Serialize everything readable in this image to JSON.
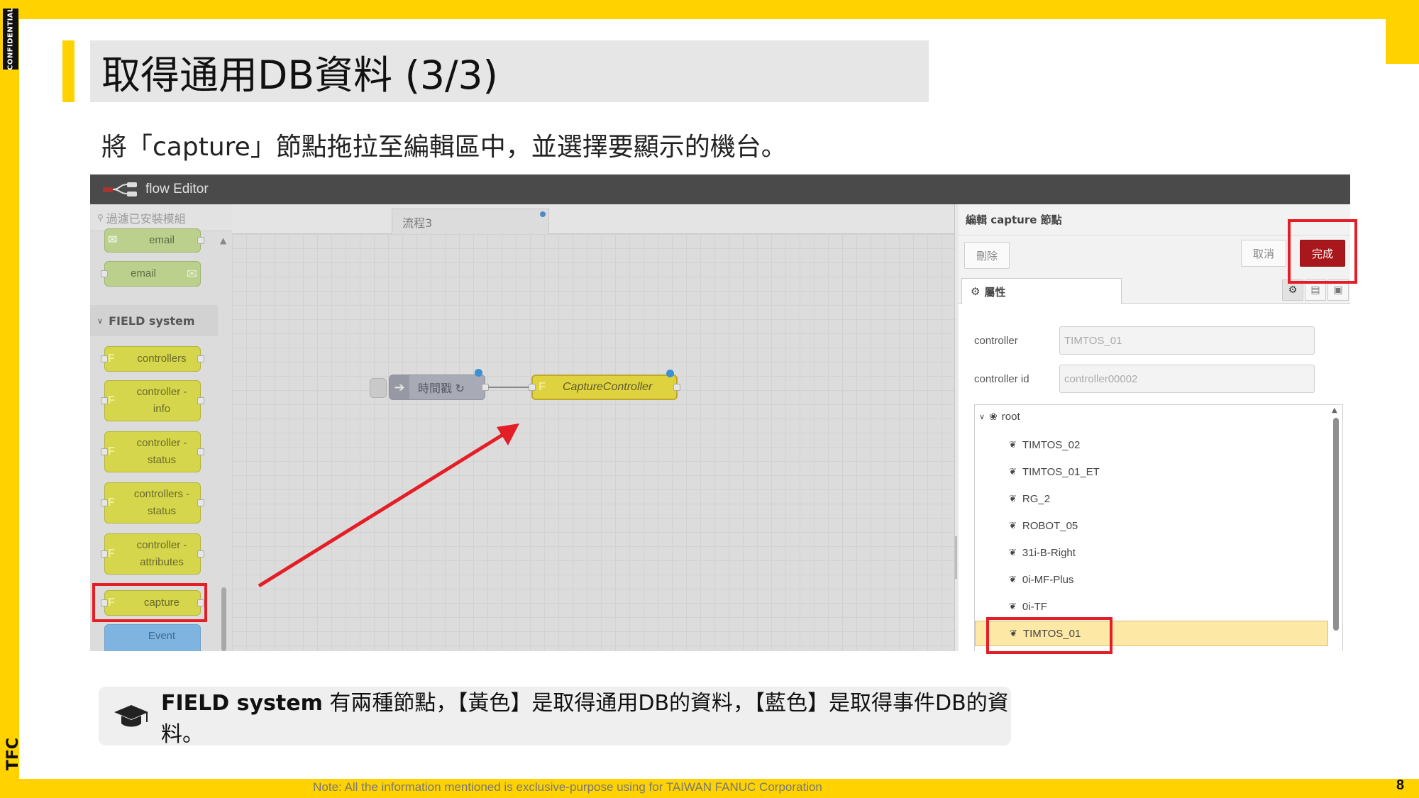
{
  "slide": {
    "confidential_label": "CONFIDENTIAL",
    "logo_text": "TFC",
    "title": "取得通用DB資料 (3/3)",
    "subtitle": "將「capture」節點拖拉至編輯區中，並選擇要顯示的機台。",
    "footer_note": "Note: All the information mentioned is exclusive-purpose using for TAIWAN FANUC Corporation",
    "page_number": "8",
    "accent_color": "#ffd200",
    "highlight_color": "#e41e26"
  },
  "editor": {
    "app_title": "flow Editor",
    "palette": {
      "search_placeholder": "過濾已安裝模組",
      "category": "FIELD system",
      "nodes": [
        {
          "label": "email",
          "color": "green"
        },
        {
          "label": "email",
          "color": "green"
        },
        {
          "label": "controllers",
          "color": "yellow"
        },
        {
          "label": "controller -\ninfo",
          "color": "yellow"
        },
        {
          "label": "controller -\nstatus",
          "color": "yellow"
        },
        {
          "label": "controllers -\nstatus",
          "color": "yellow"
        },
        {
          "label": "controller -\nattributes",
          "color": "yellow"
        },
        {
          "label": "capture",
          "color": "yellow"
        },
        {
          "label": "Event",
          "color": "blue"
        }
      ]
    },
    "workspace": {
      "tab_label": "流程3",
      "inject_node_label": "時間戳 ↻",
      "capture_node_label": "CaptureController"
    },
    "sidebar": {
      "header": "編輯 capture 節點",
      "delete_label": "刪除",
      "cancel_label": "取消",
      "done_label": "完成",
      "properties_tab": "屬性",
      "controller_label": "controller",
      "controller_value": "TIMTOS_01",
      "controller_id_label": "controller id",
      "controller_id_value": "controller00002",
      "tree_root": "root",
      "tree_items": [
        "TIMTOS_02",
        "TIMTOS_01_ET",
        "RG_2",
        "ROBOT_05",
        "31i-B-Right",
        "0i-MF-Plus",
        "0i-TF",
        "TIMTOS_01"
      ],
      "selected_item": "TIMTOS_01"
    }
  },
  "note": {
    "bold_part": "FIELD system",
    "text": " 有兩種節點，【黃色】是取得通用DB的資料，【藍色】是取得事件DB的資料。"
  }
}
